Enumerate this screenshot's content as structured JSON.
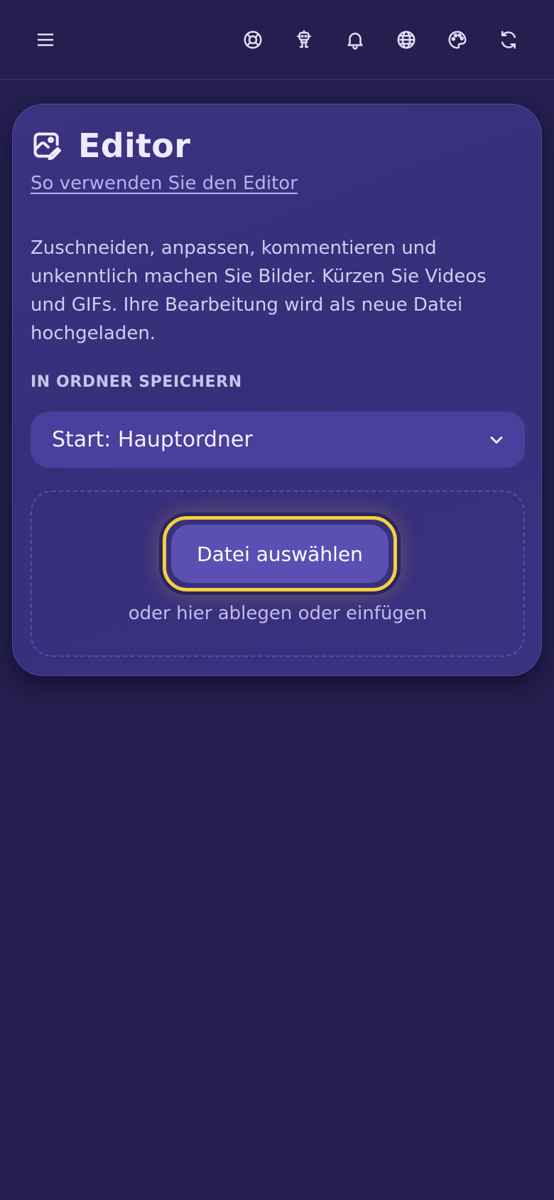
{
  "toolbar": {
    "menu_icon": "hamburger-menu-icon",
    "icons": [
      "lifebuoy-icon",
      "robot-icon",
      "bell-icon",
      "globe-icon",
      "palette-icon",
      "refresh-icon"
    ]
  },
  "editor": {
    "title": "Editor",
    "title_icon": "image-edit-icon",
    "help_link": "So verwenden Sie den Editor",
    "description": "Zuschneiden, anpassen, kommentieren und unkenntlich machen Sie Bilder. Kürzen Sie Videos und GIFs. Ihre Bearbeitung wird als neue Datei hochgeladen.",
    "folder_label": "IN ORDNER SPEICHERN",
    "folder_selected": "Start: Hauptordner",
    "choose_file_label": "Datei auswählen",
    "drop_hint": "oder hier ablegen oder einfügen"
  },
  "colors": {
    "background": "#241f4e",
    "card": "#3a3181",
    "select": "#4a3f9c",
    "button": "#5c4fb4",
    "focus_ring": "#f6cf3c",
    "link": "#b9b0f2"
  }
}
